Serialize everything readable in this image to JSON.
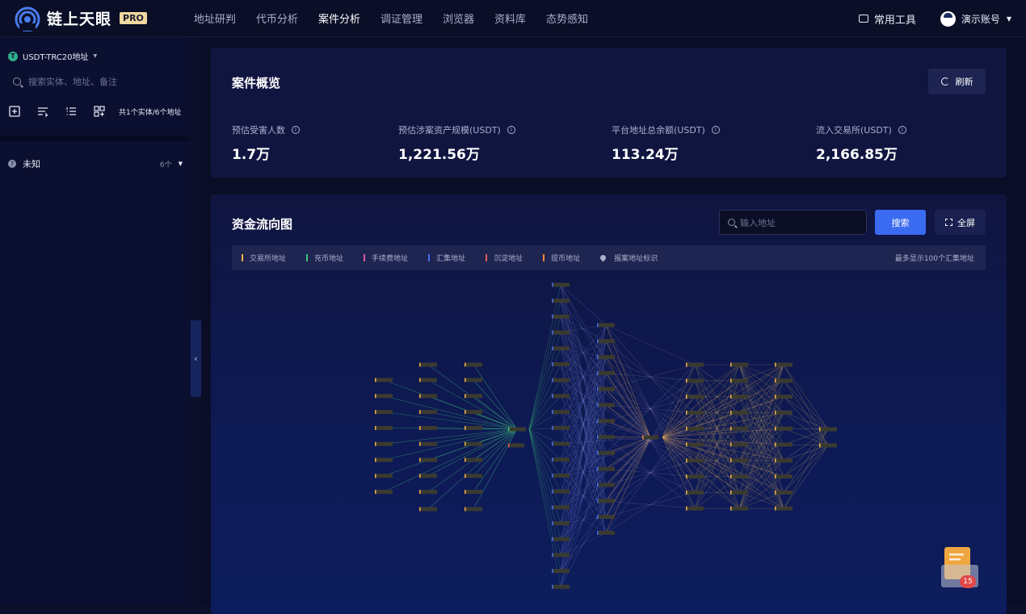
{
  "app": {
    "name": "链上天眼",
    "badge": "PRO"
  },
  "nav": [
    {
      "label": "地址研判"
    },
    {
      "label": "代币分析"
    },
    {
      "label": "案件分析",
      "active": true
    },
    {
      "label": "调证管理"
    },
    {
      "label": "浏览器"
    },
    {
      "label": "资料库"
    },
    {
      "label": "态势感知"
    }
  ],
  "header": {
    "tools_label": "常用工具",
    "account_label": "演示账号"
  },
  "sidebar": {
    "token_label": "USDT-TRC20地址",
    "search_placeholder": "搜索实体、地址、备注",
    "entity_count": "共1个实体/6个地址",
    "group": {
      "label": "未知",
      "count": "6个"
    }
  },
  "overview": {
    "title": "案件概览",
    "refresh_label": "刷新",
    "stats": [
      {
        "label": "预估受害人数",
        "value": "1.7万"
      },
      {
        "label": "预估涉案资产规模(USDT)",
        "value": "1,221.56万"
      },
      {
        "label": "平台地址总余额(USDT)",
        "value": "113.24万"
      },
      {
        "label": "流入交易所(USDT)",
        "value": "2,166.85万"
      }
    ]
  },
  "flow": {
    "title": "资金流向图",
    "input_placeholder": "输入地址",
    "search_label": "搜索",
    "fullscreen_label": "全屏",
    "legend": [
      {
        "label": "交易所地址",
        "color": "#f0b24a"
      },
      {
        "label": "充币地址",
        "color": "#3fc27a"
      },
      {
        "label": "手续费地址",
        "color": "#e0569a"
      },
      {
        "label": "汇集地址",
        "color": "#4a6cf0"
      },
      {
        "label": "沉淀地址",
        "color": "#e05a5a"
      },
      {
        "label": "提币地址",
        "color": "#f08a3a"
      }
    ],
    "legend_pin_label": "报案地址标识",
    "legend_note": "最多显示100个汇集地址"
  },
  "notification": {
    "count": "15"
  },
  "colors": {
    "accent": "#3a6bf0",
    "green": "#3fc27a",
    "orange": "#f08a3a",
    "blue": "#4a6cf0"
  }
}
